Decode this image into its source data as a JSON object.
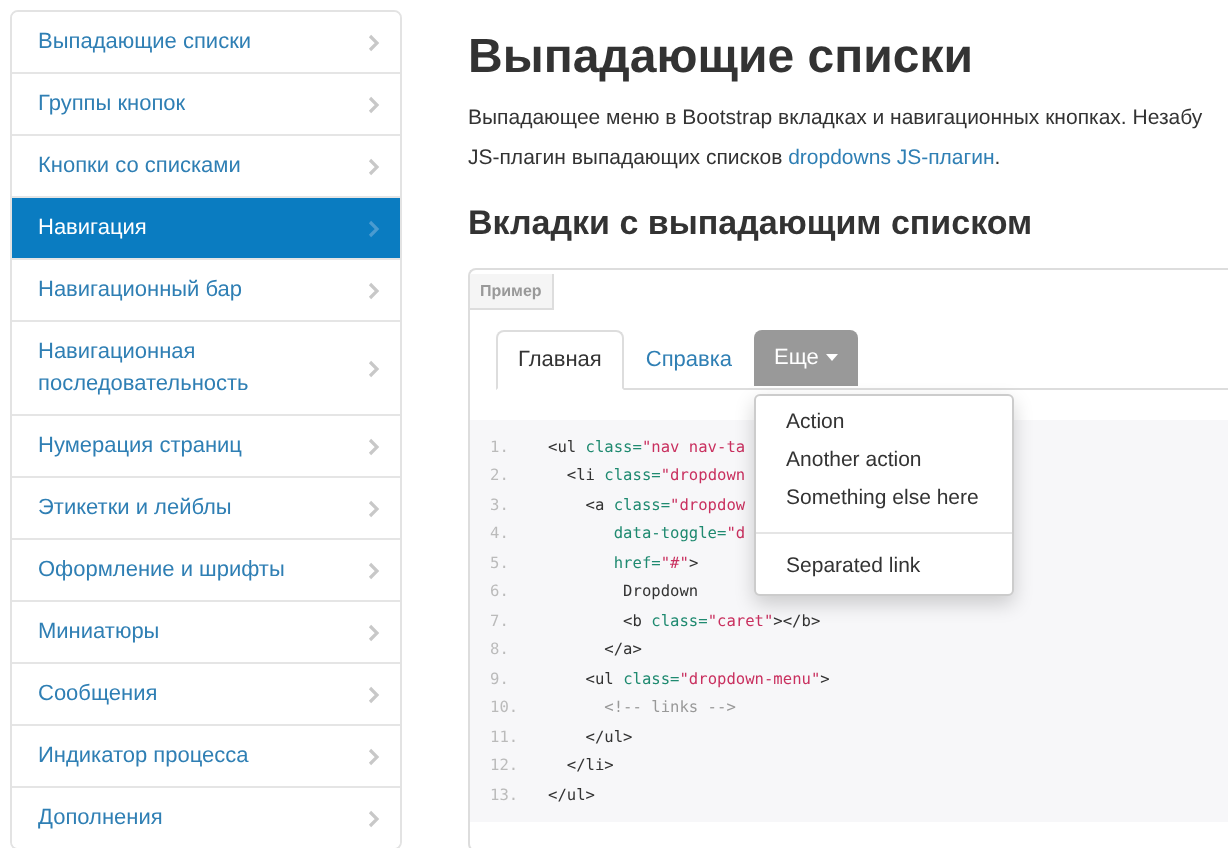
{
  "sidebar": {
    "items": [
      {
        "label": "Выпадающие списки",
        "selected": false
      },
      {
        "label": "Группы кнопок",
        "selected": false
      },
      {
        "label": "Кнопки со списками",
        "selected": false
      },
      {
        "label": "Навигация",
        "selected": true
      },
      {
        "label": "Навигационный бар",
        "selected": false
      },
      {
        "label": "Навигационная последовательность",
        "selected": false
      },
      {
        "label": "Нумерация страниц",
        "selected": false
      },
      {
        "label": "Этикетки и лейблы",
        "selected": false
      },
      {
        "label": "Оформление и шрифты",
        "selected": false
      },
      {
        "label": "Миниатюры",
        "selected": false
      },
      {
        "label": "Сообщения",
        "selected": false
      },
      {
        "label": "Индикатор процесса",
        "selected": false
      },
      {
        "label": "Дополнения",
        "selected": false
      }
    ]
  },
  "heading": "Выпадающие списки",
  "intro": {
    "line_1": "Выпадающее меню в Bootstrap вкладках и навигационных кнопках. Незабу",
    "line_2": "JS-плагин выпадающих списков ",
    "link": "dropdowns JS-плагин",
    "end": "."
  },
  "subheading": "Вкладки с выпадающим списком",
  "example": {
    "label": "Пример",
    "tabs": [
      {
        "label": "Главная",
        "selected": true,
        "kind": "tab"
      },
      {
        "label": "Справка",
        "selected": false,
        "kind": "tab"
      },
      {
        "label": "Еще",
        "kind": "dropdown",
        "open": true
      }
    ],
    "menu": [
      {
        "kind": "item",
        "label": "Action"
      },
      {
        "kind": "item",
        "label": "Another action"
      },
      {
        "kind": "item",
        "label": "Something else here"
      },
      {
        "kind": "divider"
      },
      {
        "kind": "item",
        "label": "Separated link"
      }
    ]
  },
  "code": [
    {
      "number": "1.",
      "tokens": [
        {
          "kind": "tag",
          "text": "<ul "
        },
        {
          "kind": "attr",
          "text": "class="
        },
        {
          "kind": "string",
          "text": "\"nav nav-ta"
        }
      ]
    },
    {
      "number": "2.",
      "tokens": [
        {
          "kind": "tag",
          "text": "  <li "
        },
        {
          "kind": "attr",
          "text": "class="
        },
        {
          "kind": "string",
          "text": "\"dropdown"
        }
      ]
    },
    {
      "number": "3.",
      "tokens": [
        {
          "kind": "tag",
          "text": "    <a "
        },
        {
          "kind": "attr",
          "text": "class="
        },
        {
          "kind": "string",
          "text": "\"dropdow"
        }
      ]
    },
    {
      "number": "4.",
      "tokens": [
        {
          "kind": "attr",
          "text": "       data-toggle="
        },
        {
          "kind": "string",
          "text": "\"d"
        }
      ]
    },
    {
      "number": "5.",
      "tokens": [
        {
          "kind": "attr",
          "text": "       href="
        },
        {
          "kind": "string",
          "text": "\"#\""
        },
        {
          "kind": "tag",
          "text": ">"
        }
      ]
    },
    {
      "number": "6.",
      "tokens": [
        {
          "kind": "plain",
          "text": "        Dropdown"
        }
      ]
    },
    {
      "number": "7.",
      "tokens": [
        {
          "kind": "tag",
          "text": "        <b "
        },
        {
          "kind": "attr",
          "text": "class="
        },
        {
          "kind": "string",
          "text": "\"caret\""
        },
        {
          "kind": "tag",
          "text": "></b>"
        }
      ]
    },
    {
      "number": "8.",
      "tokens": [
        {
          "kind": "tag",
          "text": "      </a>"
        }
      ]
    },
    {
      "number": "9.",
      "tokens": [
        {
          "kind": "tag",
          "text": "    <ul "
        },
        {
          "kind": "attr",
          "text": "class="
        },
        {
          "kind": "string",
          "text": "\"dropdown-menu\""
        },
        {
          "kind": "tag",
          "text": ">"
        }
      ]
    },
    {
      "number": "10.",
      "tokens": [
        {
          "kind": "comment",
          "text": "      <!-- links -->"
        }
      ]
    },
    {
      "number": "11.",
      "tokens": [
        {
          "kind": "tag",
          "text": "    </ul>"
        }
      ]
    },
    {
      "number": "12.",
      "tokens": [
        {
          "kind": "tag",
          "text": "  </li>"
        }
      ]
    },
    {
      "number": "13.",
      "tokens": [
        {
          "kind": "tag",
          "text": "</ul>"
        }
      ]
    }
  ]
}
